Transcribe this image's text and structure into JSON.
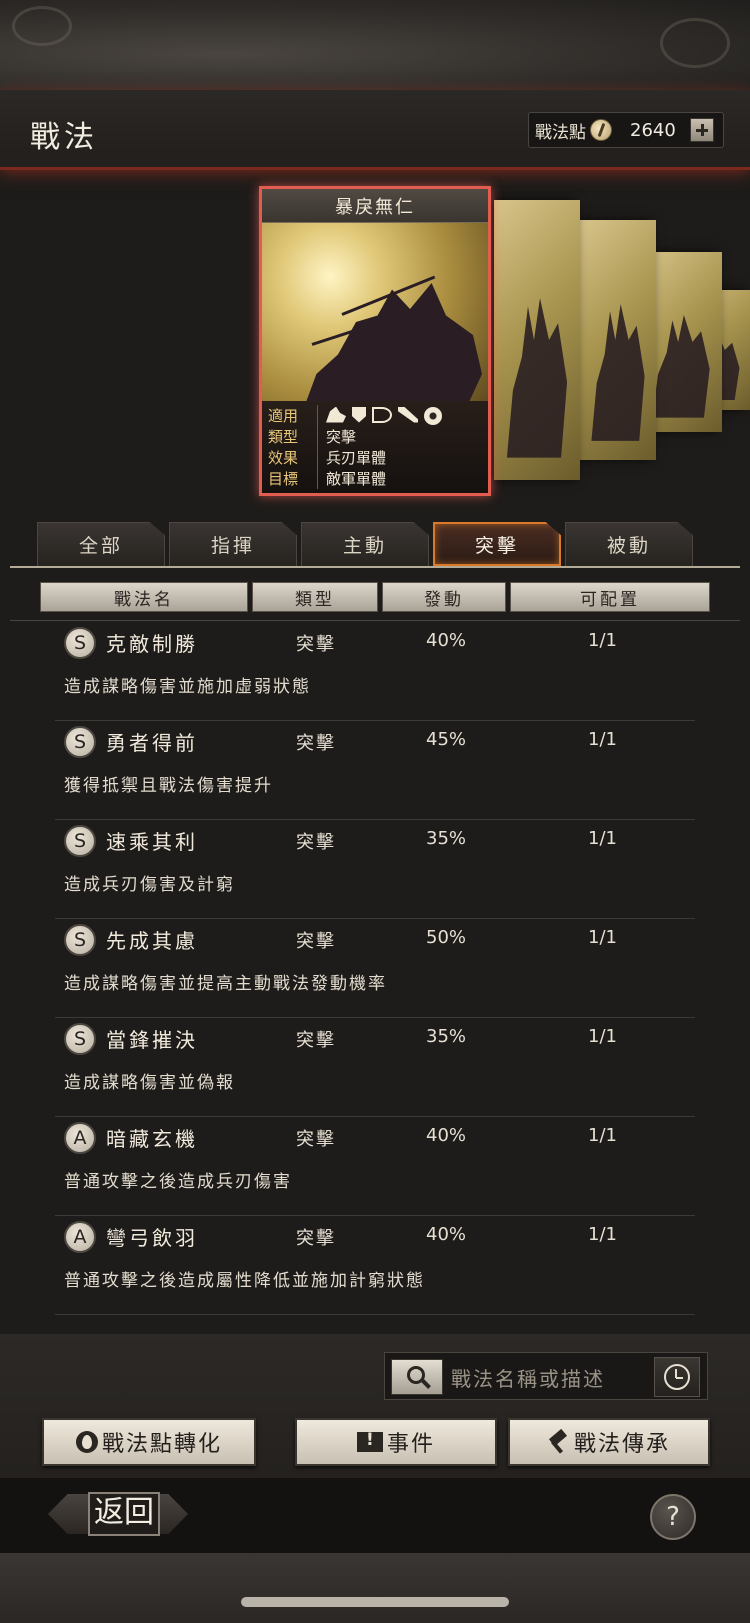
{
  "header": {
    "title": "戰法",
    "points_label": "戰法點",
    "points_value": "2640",
    "coin_icon": "coin-icon",
    "add_icon": "plus-icon"
  },
  "featured_card": {
    "title": "暴戾無仁",
    "info": [
      {
        "key": "適用",
        "value": ""
      },
      {
        "key": "類型",
        "value": "突擊"
      },
      {
        "key": "效果",
        "value": "兵刃單體"
      },
      {
        "key": "目標",
        "value": "敵軍單體"
      }
    ],
    "troop_icons": [
      "cavalry-icon",
      "shield-icon",
      "bow-icon",
      "spear-icon",
      "wheel-icon"
    ]
  },
  "tabs": [
    {
      "label": "全部",
      "active": false
    },
    {
      "label": "指揮",
      "active": false
    },
    {
      "label": "主動",
      "active": false
    },
    {
      "label": "突擊",
      "active": true
    },
    {
      "label": "被動",
      "active": false
    }
  ],
  "columns": [
    "戰法名",
    "類型",
    "發動",
    "可配置"
  ],
  "skills": [
    {
      "grade": "S",
      "name": "克敵制勝",
      "type": "突擊",
      "rate": "40%",
      "config": "1/1",
      "desc": "造成謀略傷害並施加虛弱狀態"
    },
    {
      "grade": "S",
      "name": "勇者得前",
      "type": "突擊",
      "rate": "45%",
      "config": "1/1",
      "desc": "獲得抵禦且戰法傷害提升"
    },
    {
      "grade": "S",
      "name": "速乘其利",
      "type": "突擊",
      "rate": "35%",
      "config": "1/1",
      "desc": "造成兵刃傷害及計窮"
    },
    {
      "grade": "S",
      "name": "先成其慮",
      "type": "突擊",
      "rate": "50%",
      "config": "1/1",
      "desc": "造成謀略傷害並提高主動戰法發動機率"
    },
    {
      "grade": "S",
      "name": "當鋒摧決",
      "type": "突擊",
      "rate": "35%",
      "config": "1/1",
      "desc": "造成謀略傷害並偽報"
    },
    {
      "grade": "A",
      "name": "暗藏玄機",
      "type": "突擊",
      "rate": "40%",
      "config": "1/1",
      "desc": "普通攻擊之後造成兵刃傷害"
    },
    {
      "grade": "A",
      "name": "彎弓飲羽",
      "type": "突擊",
      "rate": "40%",
      "config": "1/1",
      "desc": "普通攻擊之後造成屬性降低並施加計窮狀態"
    }
  ],
  "search": {
    "placeholder": "戰法名稱或描述",
    "search_icon": "search-icon",
    "history_icon": "clock-icon"
  },
  "actions": {
    "convert_label": "戰法點轉化",
    "event_label": "事件",
    "inherit_label": "戰法傳承"
  },
  "footer": {
    "back_label": "返回",
    "help_label": "?"
  }
}
